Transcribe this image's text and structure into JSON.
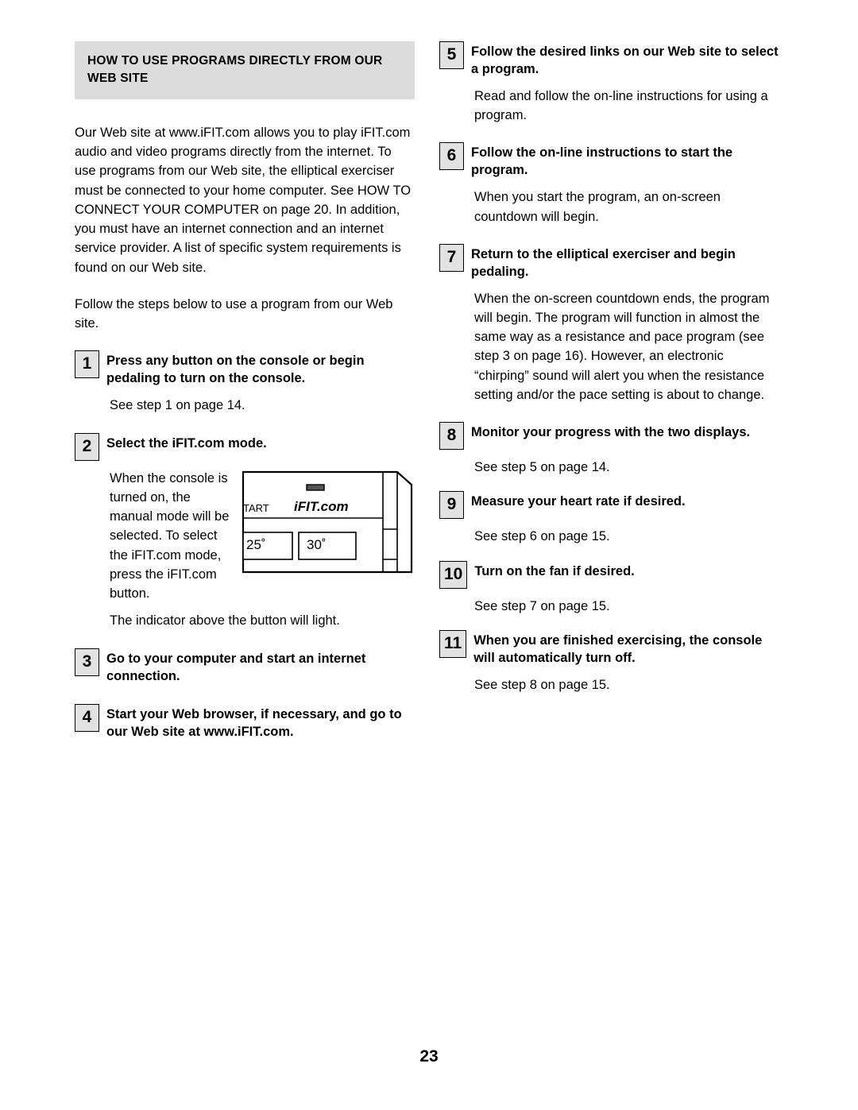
{
  "page": {
    "number": "23"
  },
  "left": {
    "header": "HOW TO USE PROGRAMS DIRECTLY FROM OUR WEB SITE",
    "intro1": "Our Web site at www.iFIT.com allows you to play iFIT.com audio and video programs directly from the internet. To use programs from our Web site, the elliptical exerciser must be connected to your home computer. See HOW TO CONNECT YOUR COMPUTER on page 20. In addition, you must have an internet connection and an internet service provider. A list of specific system requirements is found on our Web site.",
    "intro2": "Follow the steps below to use a program from our Web site.",
    "steps": [
      {
        "number": "1",
        "title": "Press any button on the console or begin pedaling to turn on the console.",
        "body": "See step 1 on page 14."
      },
      {
        "number": "2",
        "title": "Select the iFIT.com mode.",
        "figure_text": "When the console is turned on, the manual mode will be selected. To select the iFIT.com mode, press the iFIT.com button.",
        "body": "The indicator above the button will light."
      },
      {
        "number": "3",
        "title": "Go to your computer and start an internet connection."
      },
      {
        "number": "4",
        "title": "Start your Web browser, if necessary, and go to our Web site at www.iFIT.com."
      }
    ],
    "console_figure": {
      "start_label": "TART",
      "logo": "iFIT.com",
      "display_left": "25˚",
      "display_right": "30˚"
    }
  },
  "right": {
    "steps": [
      {
        "number": "5",
        "title": "Follow the desired links on our Web site to select a program.",
        "body": "Read and follow the on-line instructions for using a program."
      },
      {
        "number": "6",
        "title": "Follow the on-line instructions to start the program.",
        "body": "When you start the program, an on-screen countdown will begin."
      },
      {
        "number": "7",
        "title": "Return to the elliptical exerciser and begin pedaling.",
        "body": "When the on-screen countdown ends, the program will begin. The program will function in almost the same way as a resistance and pace program (see step 3 on page 16). However, an electronic “chirping” sound will alert you when the resistance setting and/or the pace setting is about to change."
      },
      {
        "number": "8",
        "title": "Monitor your progress with the two displays.",
        "body": "See step 5 on page 14."
      },
      {
        "number": "9",
        "title": "Measure your heart rate if desired.",
        "body": "See step 6 on page 15."
      },
      {
        "number": "10",
        "title": "Turn on the fan if desired.",
        "body": "See step 7 on page 15."
      },
      {
        "number": "11",
        "title": "When you are finished exercising, the console will automatically turn off.",
        "body": "See step 8 on page 15."
      }
    ]
  }
}
